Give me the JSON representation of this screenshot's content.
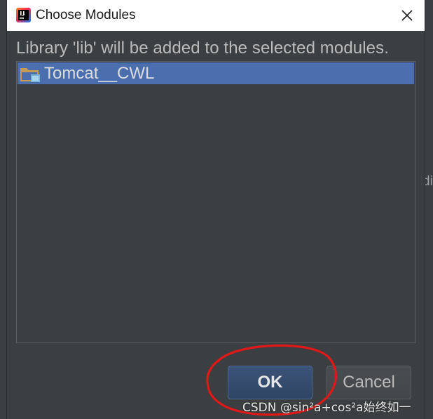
{
  "window": {
    "title": "Choose Modules",
    "app_icon": "intellij-idea-icon",
    "close_icon": "close-icon"
  },
  "dialog": {
    "message": "Library 'lib' will be added to the selected modules.",
    "modules": [
      {
        "label": "Tomcat__CWL",
        "icon": "module-folder-icon",
        "selected": true
      }
    ]
  },
  "buttons": {
    "ok_label": "OK",
    "cancel_label": "Cancel"
  },
  "background": {
    "peek_text": "di"
  },
  "overlay": {
    "annotation": "red-ellipse",
    "watermark": "CSDN @sin²a+cos²a始终如一"
  },
  "colors": {
    "dialog_bg": "#3c3f41",
    "selection": "#4b6eaf",
    "default_button": "#2f4565",
    "annotation": "#e01818"
  }
}
